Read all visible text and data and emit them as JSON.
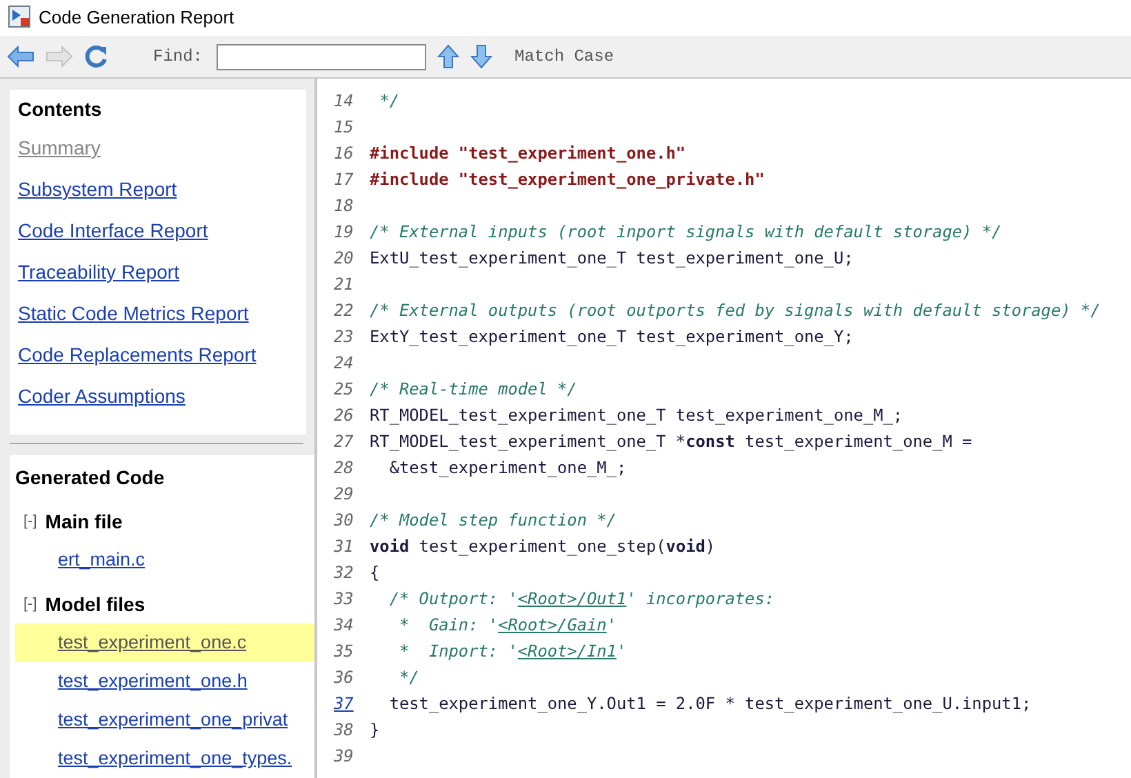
{
  "window": {
    "title": "Code Generation Report"
  },
  "toolbar": {
    "find_label": "Find:",
    "match_case": "Match Case"
  },
  "contents": {
    "title": "Contents",
    "items": [
      {
        "label": "Summary",
        "disabled": true
      },
      {
        "label": "Subsystem Report",
        "disabled": false
      },
      {
        "label": "Code Interface Report",
        "disabled": false
      },
      {
        "label": "Traceability Report",
        "disabled": false
      },
      {
        "label": "Static Code Metrics Report",
        "disabled": false
      },
      {
        "label": "Code Replacements Report",
        "disabled": false
      },
      {
        "label": "Coder Assumptions",
        "disabled": false
      }
    ]
  },
  "generated_code": {
    "title": "Generated Code",
    "groups": [
      {
        "toggle": "[-]",
        "label": "Main file",
        "files": [
          {
            "name": "ert_main.c",
            "selected": false
          }
        ]
      },
      {
        "toggle": "[-]",
        "label": "Model files",
        "files": [
          {
            "name": "test_experiment_one.c",
            "selected": true
          },
          {
            "name": "test_experiment_one.h",
            "selected": false
          },
          {
            "name": "test_experiment_one_privat",
            "selected": false
          },
          {
            "name": "test_experiment_one_types.",
            "selected": false
          }
        ]
      }
    ]
  },
  "code_lines": [
    {
      "number": "14",
      "link": false,
      "segments": [
        {
          "kind": "comment",
          "text": " */"
        }
      ]
    },
    {
      "number": "15",
      "link": false
    },
    {
      "number": "16",
      "link": false,
      "segments": [
        {
          "kind": "pre",
          "text": "#include \"test_experiment_one.h\""
        }
      ]
    },
    {
      "number": "17",
      "link": false,
      "segments": [
        {
          "kind": "pre",
          "text": "#include \"test_experiment_one_private.h\""
        }
      ]
    },
    {
      "number": "18",
      "link": false
    },
    {
      "number": "19",
      "link": false,
      "segments": [
        {
          "kind": "comment",
          "text": "/* External inputs (root inport signals with default storage) */"
        }
      ]
    },
    {
      "number": "20",
      "link": false,
      "segments": [
        {
          "kind": "code",
          "text": "ExtU_test_experiment_one_T test_experiment_one_U;"
        }
      ]
    },
    {
      "number": "21",
      "link": false
    },
    {
      "number": "22",
      "link": false,
      "segments": [
        {
          "kind": "comment",
          "text": "/* External outputs (root outports fed by signals with default storage) */"
        }
      ]
    },
    {
      "number": "23",
      "link": false,
      "segments": [
        {
          "kind": "code",
          "text": "ExtY_test_experiment_one_T test_experiment_one_Y;"
        }
      ]
    },
    {
      "number": "24",
      "link": false
    },
    {
      "number": "25",
      "link": false,
      "segments": [
        {
          "kind": "comment",
          "text": "/* Real-time model */"
        }
      ]
    },
    {
      "number": "26",
      "link": false,
      "segments": [
        {
          "kind": "code",
          "text": "RT_MODEL_test_experiment_one_T test_experiment_one_M_;"
        }
      ]
    },
    {
      "number": "27",
      "link": false,
      "segments": [
        {
          "kind": "code",
          "text": "RT_MODEL_test_experiment_one_T *"
        },
        {
          "kind": "keyword",
          "text": "const"
        },
        {
          "kind": "code",
          "text": " test_experiment_one_M ="
        }
      ]
    },
    {
      "number": "28",
      "link": false,
      "segments": [
        {
          "kind": "code",
          "text": "  &test_experiment_one_M_;"
        }
      ]
    },
    {
      "number": "29",
      "link": false
    },
    {
      "number": "30",
      "link": false,
      "segments": [
        {
          "kind": "comment",
          "text": "/* Model step function */"
        }
      ]
    },
    {
      "number": "31",
      "link": false,
      "segments": [
        {
          "kind": "keyword",
          "text": "void"
        },
        {
          "kind": "code",
          "text": " test_experiment_one_step("
        },
        {
          "kind": "keyword",
          "text": "void"
        },
        {
          "kind": "code",
          "text": ")"
        }
      ]
    },
    {
      "number": "32",
      "link": false,
      "segments": [
        {
          "kind": "code",
          "text": "{"
        }
      ]
    },
    {
      "number": "33",
      "link": false,
      "segments": [
        {
          "kind": "comment",
          "text": "  /* Outport: '"
        },
        {
          "kind": "comment_link",
          "text": "<Root>/Out1"
        },
        {
          "kind": "comment",
          "text": "' incorporates:"
        }
      ]
    },
    {
      "number": "34",
      "link": false,
      "segments": [
        {
          "kind": "comment",
          "text": "   *  Gain: '"
        },
        {
          "kind": "comment_link",
          "text": "<Root>/Gain"
        },
        {
          "kind": "comment",
          "text": "'"
        }
      ]
    },
    {
      "number": "35",
      "link": false,
      "segments": [
        {
          "kind": "comment",
          "text": "   *  Inport: '"
        },
        {
          "kind": "comment_link",
          "text": "<Root>/In1"
        },
        {
          "kind": "comment",
          "text": "'"
        }
      ]
    },
    {
      "number": "36",
      "link": false,
      "segments": [
        {
          "kind": "comment",
          "text": "   */"
        }
      ]
    },
    {
      "number": "37",
      "link": true,
      "segments": [
        {
          "kind": "code",
          "text": "  test_experiment_one_Y.Out1 = 2.0F * test_experiment_one_U.input1;"
        }
      ]
    },
    {
      "number": "38",
      "link": false,
      "segments": [
        {
          "kind": "code",
          "text": "}"
        }
      ]
    },
    {
      "number": "39",
      "link": false
    }
  ]
}
